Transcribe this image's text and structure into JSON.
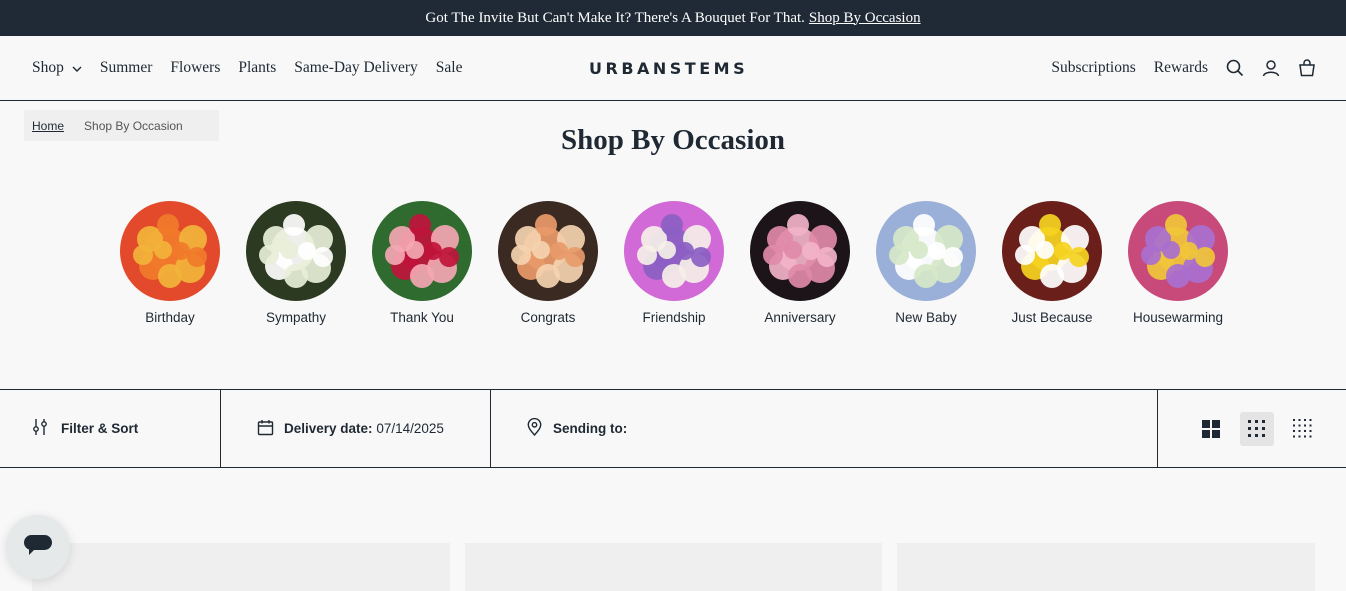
{
  "announcement": {
    "text": "Got The Invite But Can't Make It? There's A Bouquet For That.",
    "link": "Shop By Occasion"
  },
  "header": {
    "nav_left": [
      "Shop",
      "Summer",
      "Flowers",
      "Plants",
      "Same-Day Delivery",
      "Sale"
    ],
    "logo": "URBANSTEMS",
    "nav_right": [
      "Subscriptions",
      "Rewards"
    ],
    "icons": [
      "chevron-down-icon",
      "search-icon",
      "account-icon",
      "cart-icon"
    ]
  },
  "breadcrumb": {
    "home": "Home",
    "current": "Shop By Occasion"
  },
  "page_title": "Shop By Occasion",
  "occasions": [
    {
      "label": "Birthday",
      "colors": [
        "#f07a2a",
        "#f2b33a",
        "#e24a2b"
      ]
    },
    {
      "label": "Sympathy",
      "colors": [
        "#ffffff",
        "#e8efd8",
        "#2c3a22"
      ]
    },
    {
      "label": "Thank You",
      "colors": [
        "#c0133b",
        "#f4a7b3",
        "#2f6b2f"
      ]
    },
    {
      "label": "Congrats",
      "colors": [
        "#e99a6a",
        "#f5d3b0",
        "#3a2a22"
      ]
    },
    {
      "label": "Friendship",
      "colors": [
        "#8b5fc2",
        "#f5f0e8",
        "#d16ad6"
      ]
    },
    {
      "label": "Anniversary",
      "colors": [
        "#f2b3c8",
        "#e08aa8",
        "#1c1418"
      ]
    },
    {
      "label": "New Baby",
      "colors": [
        "#ffffff",
        "#d6e8c8",
        "#9bb0d8"
      ]
    },
    {
      "label": "Just Because",
      "colors": [
        "#f5d320",
        "#ffffff",
        "#6a1f1a"
      ]
    },
    {
      "label": "Housewarming",
      "colors": [
        "#f0c63a",
        "#a86fd0",
        "#c84a7a"
      ]
    }
  ],
  "filterbar": {
    "filter_label": "Filter & Sort",
    "delivery_label": "Delivery date:",
    "delivery_value": "07/14/2025",
    "sending_label": "Sending to:",
    "views": [
      "grid-large-icon",
      "grid-medium-icon",
      "grid-small-icon"
    ],
    "active_view": "grid-medium-icon"
  },
  "colors": {
    "announcement_bg": "#1f2a36",
    "text": "#1f2933",
    "page_bg": "#f8f8f8"
  }
}
